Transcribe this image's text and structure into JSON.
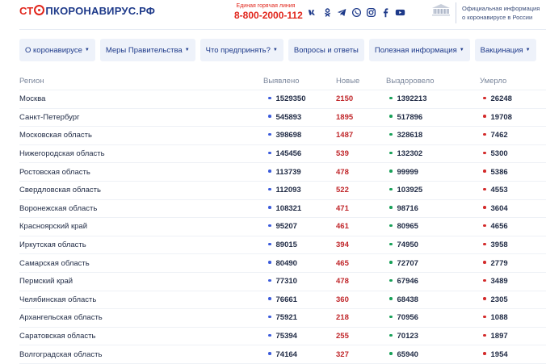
{
  "header": {
    "logo": {
      "part1": "СТ",
      "part2": "ПКОРОНАВИРУС.РФ"
    },
    "hotline_caption": "Единая горячая линия",
    "hotline_phone": "8-800-2000-112",
    "social_icons": [
      "vk-icon",
      "odnoklassniki-icon",
      "telegram-icon",
      "viber-icon",
      "instagram-icon",
      "facebook-icon",
      "youtube-icon"
    ],
    "gov_text_line1": "Официальная информация",
    "gov_text_line2": "о коронавирусе в России"
  },
  "nav": [
    {
      "label": "О коронавирусе",
      "dropdown": true
    },
    {
      "label": "Меры Правительства",
      "dropdown": true
    },
    {
      "label": "Что предпринять?",
      "dropdown": true
    },
    {
      "label": "Вопросы и ответы",
      "dropdown": false
    },
    {
      "label": "Полезная информация",
      "dropdown": true
    },
    {
      "label": "Вакцинация",
      "dropdown": true
    }
  ],
  "table": {
    "headers": {
      "region": "Регион",
      "confirmed": "Выявлено",
      "new": "Новые",
      "recovered": "Выздоровело",
      "died": "Умерло"
    },
    "rows": [
      {
        "region": "Москва",
        "confirmed": "1529350",
        "new": "2150",
        "recovered": "1392213",
        "died": "26248"
      },
      {
        "region": "Санкт-Петербург",
        "confirmed": "545893",
        "new": "1895",
        "recovered": "517896",
        "died": "19708"
      },
      {
        "region": "Московская область",
        "confirmed": "398698",
        "new": "1487",
        "recovered": "328618",
        "died": "7462"
      },
      {
        "region": "Нижегородская область",
        "confirmed": "145456",
        "new": "539",
        "recovered": "132302",
        "died": "5300"
      },
      {
        "region": "Ростовская область",
        "confirmed": "113739",
        "new": "478",
        "recovered": "99999",
        "died": "5386"
      },
      {
        "region": "Свердловская область",
        "confirmed": "112093",
        "new": "522",
        "recovered": "103925",
        "died": "4553"
      },
      {
        "region": "Воронежская область",
        "confirmed": "108321",
        "new": "471",
        "recovered": "98716",
        "died": "3604"
      },
      {
        "region": "Красноярский край",
        "confirmed": "95207",
        "new": "461",
        "recovered": "80965",
        "died": "4656"
      },
      {
        "region": "Иркутская область",
        "confirmed": "89015",
        "new": "394",
        "recovered": "74950",
        "died": "3958"
      },
      {
        "region": "Самарская область",
        "confirmed": "80490",
        "new": "465",
        "recovered": "72707",
        "died": "2779"
      },
      {
        "region": "Пермский край",
        "confirmed": "77310",
        "new": "478",
        "recovered": "67946",
        "died": "3489"
      },
      {
        "region": "Челябинская область",
        "confirmed": "76661",
        "new": "360",
        "recovered": "68438",
        "died": "2305"
      },
      {
        "region": "Архангельская область",
        "confirmed": "75921",
        "new": "218",
        "recovered": "70956",
        "died": "1088"
      },
      {
        "region": "Саратовская область",
        "confirmed": "75394",
        "new": "255",
        "recovered": "70123",
        "died": "1897"
      },
      {
        "region": "Волгоградская область",
        "confirmed": "74164",
        "new": "327",
        "recovered": "65940",
        "died": "1954"
      }
    ]
  },
  "colors": {
    "brand_blue": "#1e3a8a",
    "brand_red": "#e1261c",
    "confirmed_dot": "#3b5bdb",
    "recovered_dot": "#18a058",
    "died_dot": "#d32a2a"
  }
}
